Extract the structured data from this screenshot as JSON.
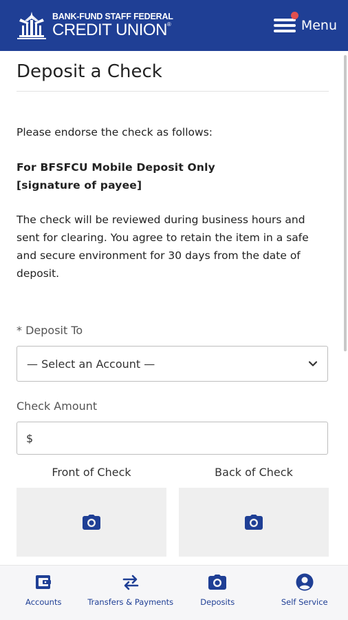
{
  "header": {
    "logo_line1": "BANK-FUND STAFF FEDERAL",
    "logo_line2": "CREDIT UNION",
    "logo_registered": "®",
    "menu_label": "Menu",
    "brand_color": "#1f3f95",
    "notification_dot_color": "#e0504f"
  },
  "page": {
    "title": "Deposit a Check",
    "endorse_instruction": "Please endorse the check as follows:",
    "endorse_line1": "For BFSFCU Mobile Deposit Only",
    "endorse_line2": "[signature of payee]",
    "review_text": "The check will be reviewed during business hours and sent for clearing. You agree to retain the item in a safe and secure environment for 30 days from the date of deposit."
  },
  "form": {
    "deposit_to_label": "* Deposit To",
    "deposit_to_value": "— Select an Account —",
    "amount_label": "Check Amount",
    "amount_prefix": "$",
    "front_label": "Front of Check",
    "back_label": "Back of Check",
    "front_icon": "camera-icon",
    "back_icon": "camera-icon"
  },
  "bottom_nav": {
    "items": [
      {
        "label": "Accounts",
        "icon": "wallet-icon"
      },
      {
        "label": "Transfers & Payments",
        "icon": "transfer-arrows-icon"
      },
      {
        "label": "Deposits",
        "icon": "camera-icon"
      },
      {
        "label": "Self Service",
        "icon": "user-circle-icon"
      }
    ]
  }
}
